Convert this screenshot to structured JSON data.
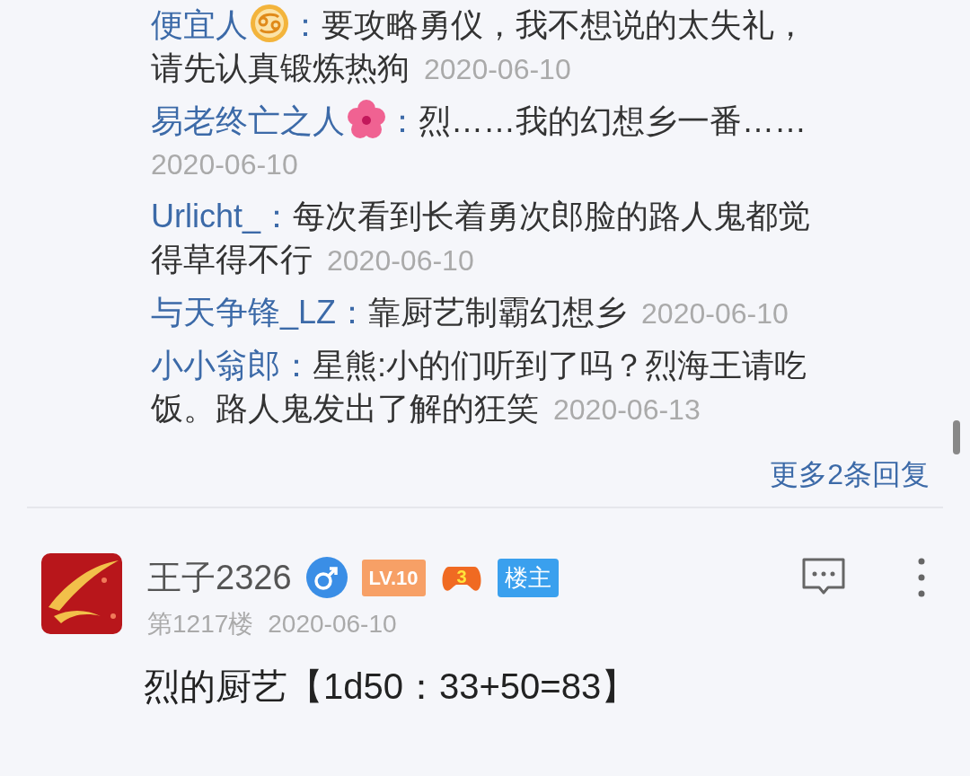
{
  "replies": [
    {
      "author": "便宜人",
      "kind": "zodiac",
      "colon": "：",
      "lines": [
        "要攻略勇仪，我不想说的太失礼，",
        "请先认真锻炼热狗"
      ],
      "date": "2020-06-10"
    },
    {
      "author": "易老终亡之人",
      "kind": "flower",
      "colon": "：",
      "lines": [
        "烈……我的幻想乡一番……"
      ],
      "date": "2020-06-10"
    },
    {
      "author": "Urlicht_",
      "kind": "plain",
      "colon": "：",
      "lines": [
        "每次看到长着勇次郎脸的路人鬼都觉",
        "得草得不行"
      ],
      "date": "2020-06-10"
    },
    {
      "author": "与天争锋_LZ",
      "kind": "plain",
      "colon": "：",
      "lines": [
        "靠厨艺制霸幻想乡"
      ],
      "date": "2020-06-10"
    },
    {
      "author": "小小翁郎",
      "kind": "plain",
      "colon": "：",
      "lines": [
        "星熊:小的们听到了吗？烈海王请吃",
        "饭。路人鬼发出了解的狂笑"
      ],
      "date": "2020-06-13"
    }
  ],
  "more_replies": "更多2条回复",
  "post": {
    "username": "王子2326",
    "level": "LV.10",
    "game_level": "3",
    "owner_tag": "楼主",
    "floor": "第1217楼",
    "date": "2020-06-10",
    "content": "烈的厨艺【1d50：33+50=83】"
  }
}
